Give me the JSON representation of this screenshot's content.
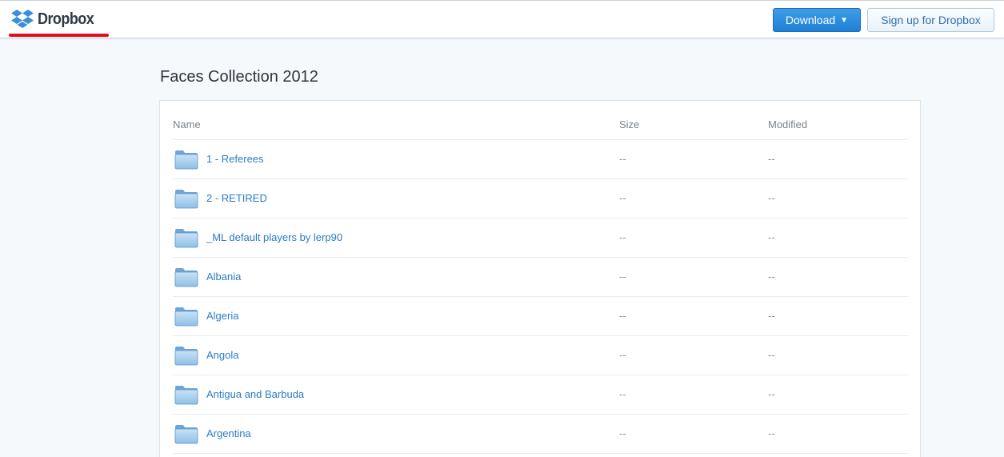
{
  "header": {
    "logo_text": "Dropbox",
    "download_label": "Download",
    "download_caret": "▼",
    "signup_label": "Sign up for Dropbox"
  },
  "folder": {
    "title": "Faces Collection 2012"
  },
  "table": {
    "columns": [
      "Name",
      "Size",
      "Modified"
    ],
    "rows": [
      {
        "name": "1 - Referees",
        "size": "--",
        "modified": "--"
      },
      {
        "name": "2 - RETIRED",
        "size": "--",
        "modified": "--"
      },
      {
        "name": "_ML default players by lerp90",
        "size": "--",
        "modified": "--"
      },
      {
        "name": "Albania",
        "size": "--",
        "modified": "--"
      },
      {
        "name": "Algeria",
        "size": "--",
        "modified": "--"
      },
      {
        "name": "Angola",
        "size": "--",
        "modified": "--"
      },
      {
        "name": "Antigua and Barbuda",
        "size": "--",
        "modified": "--"
      },
      {
        "name": "Argentina",
        "size": "--",
        "modified": "--"
      }
    ]
  },
  "icons": {
    "logo": "dropbox-logo-icon",
    "row": "folder-icon",
    "download": "caret-down-icon"
  },
  "colors": {
    "accent": "#1f7fd4",
    "link": "#2a7cc7",
    "highlight_underline": "#e60d1a",
    "background": "#f5f9fc"
  }
}
